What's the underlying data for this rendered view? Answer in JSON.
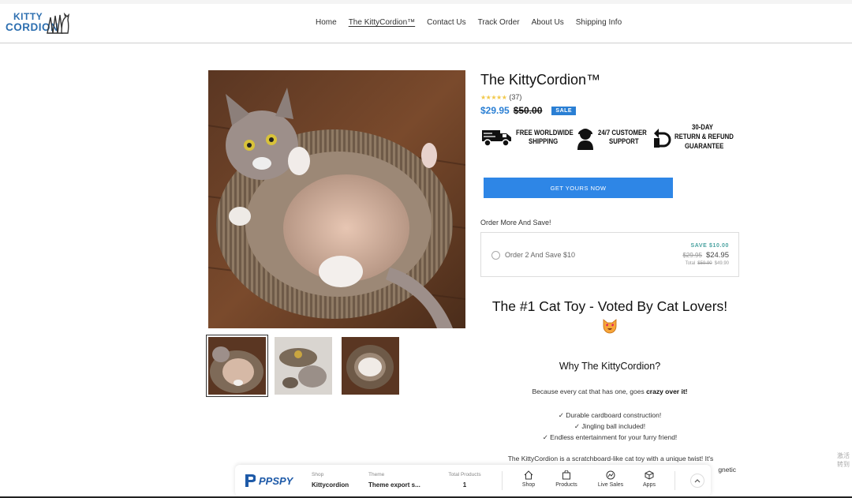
{
  "header": {
    "logo_alt": "KittyCordion",
    "logo_line1": "KITTY",
    "logo_line2": "CORDION",
    "nav": [
      {
        "label": "Home"
      },
      {
        "label": "The KittyCordion™"
      },
      {
        "label": "Contact Us"
      },
      {
        "label": "Track Order"
      },
      {
        "label": "About Us"
      },
      {
        "label": "Shipping Info"
      }
    ]
  },
  "product": {
    "title": "The KittyCordion™",
    "rating_stars": 5,
    "review_count": "(37)",
    "price": "$29.95",
    "compare_price": "$50.00",
    "sale_badge": "SALE",
    "trust_badges": [
      {
        "icon": "truck-icon",
        "line1": "FREE WORLDWIDE",
        "line2": "SHIPPING"
      },
      {
        "icon": "support-agent-icon",
        "line1": "24/7 CUSTOMER",
        "line2": "SUPPORT"
      },
      {
        "icon": "return-arrow-icon",
        "line1": "30-DAY",
        "line2": "RETURN & REFUND",
        "line3": "GUARANTEE"
      }
    ],
    "cta_label": "GET YOURS NOW",
    "order_more_label": "Order More And Save!",
    "bundle": {
      "option_label": "Order 2 And Save $10",
      "save_label": "SAVE $10.00",
      "old_unit_price": "$29.95",
      "unit_price": "$24.95",
      "total_label": "Total",
      "old_total": "$59.90",
      "total": "$49.90"
    },
    "headline": "The #1 Cat Toy - Voted By Cat Lovers!",
    "headline_emoji": "heart-eyes-cat-icon",
    "why_title": "Why The KittyCordion?",
    "lead_text": "Because every cat that has one, goes ",
    "lead_bold": "crazy over it!",
    "features": [
      "✓ Durable cardboard construction!",
      "✓ Jingling ball included!",
      "✓ Endless entertainment for your furry friend!"
    ],
    "description_line1": "The KittyCordion is a scratchboard-like cat toy with a unique twist! It's",
    "description_line2": "gnetic"
  },
  "ppspy": {
    "brand": "PPSPY",
    "shop_label": "Shop",
    "shop_value": "Kittycordion",
    "theme_label": "Theme",
    "theme_value": "Theme export s...",
    "products_label": "Total Products",
    "products_value": "1",
    "buttons": [
      {
        "label": "Shop",
        "icon": "home-icon"
      },
      {
        "label": "Products",
        "icon": "bag-icon"
      },
      {
        "label": "Live Sales",
        "icon": "sales-icon"
      },
      {
        "label": "Apps",
        "icon": "cube-icon"
      }
    ]
  },
  "side_text": "激活 转到"
}
